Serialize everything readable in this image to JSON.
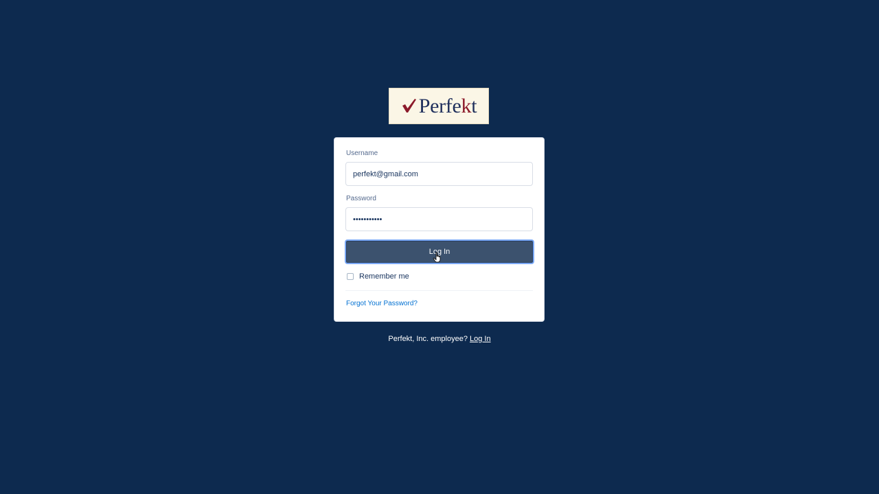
{
  "logo": {
    "text_main": "Perfe",
    "text_k": "k",
    "text_end": "t",
    "check_color": "#8c1a2a",
    "text_color": "#1f2f5c"
  },
  "form": {
    "username_label": "Username",
    "username_value": "perfekt@gmail.com",
    "password_label": "Password",
    "password_value": "•••••••••••",
    "login_button": "Log In",
    "remember_label": "Remember me",
    "remember_checked": false,
    "forgot_link": "Forgot Your Password?"
  },
  "footer": {
    "text": "Perfekt, Inc. employee?",
    "link": "Log In"
  },
  "colors": {
    "background": "#0d2a4f",
    "button": "#3c526e",
    "button_focus_ring": "#7aa8f5",
    "link": "#0070d2"
  }
}
